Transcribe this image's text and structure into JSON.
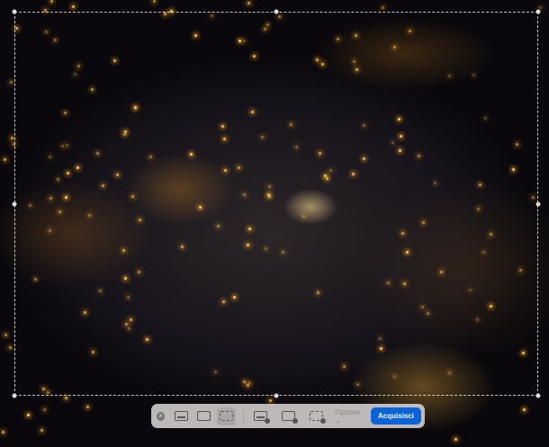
{
  "toolbar": {
    "options_label": "Opzioni",
    "options_chevron": "⌄",
    "capture_label": "Acquisisci",
    "close_glyph": "×",
    "icons": [
      "close-icon",
      "capture-entire-screen-icon",
      "capture-window-icon",
      "capture-selection-icon",
      "record-entire-screen-icon",
      "record-window-icon",
      "record-selection-icon"
    ]
  },
  "colors": {
    "accent": "#0a63d8"
  }
}
